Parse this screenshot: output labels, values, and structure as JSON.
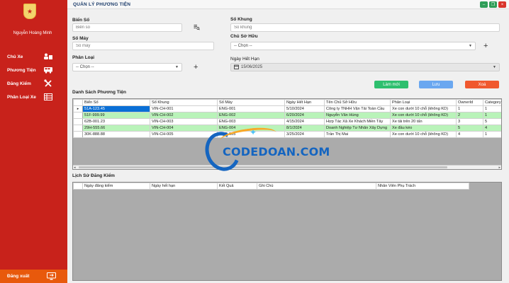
{
  "app": {
    "title": "QUẢN LÝ PHƯƠNG TIỆN",
    "user_name": "Nguyễn Hoàng Minh"
  },
  "sidebar": {
    "items": [
      {
        "label": "Chủ Xe",
        "icon": "owners-icon"
      },
      {
        "label": "Phương Tiện",
        "icon": "bus-icon"
      },
      {
        "label": "Đăng Kiểm",
        "icon": "tools-icon"
      },
      {
        "label": "Phân Loại Xe",
        "icon": "category-icon"
      }
    ],
    "logout_label": "Đăng xuất"
  },
  "form": {
    "bien_so": {
      "label": "Biển Số",
      "placeholder": "Biển số"
    },
    "so_may": {
      "label": "Số Máy",
      "placeholder": "Số máy"
    },
    "phan_loai": {
      "label": "Phân Loại",
      "value": "-- Chọn --"
    },
    "so_khung": {
      "label": "Số Khung",
      "placeholder": "Số khung"
    },
    "chu_so_huu": {
      "label": "Chủ Sở Hữu",
      "value": "-- Chọn --"
    },
    "ngay_het_han": {
      "label": "Ngày Hết Hạn",
      "value": "15/06/2025"
    },
    "plus": "+",
    "buttons": {
      "add": "Làm mới",
      "save": "Lưu",
      "delete": "Xoá"
    }
  },
  "vehicles": {
    "title": "Danh Sách Phương Tiện",
    "columns": [
      "Biển Số",
      "Số Khung",
      "Số Máy",
      "Ngày Hết Hạn",
      "Tên Chủ Sở Hữu",
      "Phân Loại",
      "OwnerId",
      "CategoryId"
    ],
    "rows": [
      [
        "51A-123.45",
        "VIN-CH-001",
        "ENG-001",
        "5/10/2024",
        "Công ty TNHH Vận Tải Toàn Cầu",
        "Xe con dưới 10 chỗ (không KD)",
        "1",
        "1"
      ],
      [
        "51F-999.99",
        "VIN-CH-002",
        "ENG-002",
        "6/20/2024",
        "Nguyễn Văn Hùng",
        "Xe con dưới 10 chỗ (không KD)",
        "2",
        "1"
      ],
      [
        "62B-001.23",
        "VIN-CH-003",
        "ENG-003",
        "4/15/2024",
        "Hợp Tác Xã Xe Khách Miền Tây",
        "Xe tải trên 20 tấn",
        "3",
        "5"
      ],
      [
        "29H-555.66",
        "VIN-CH-004",
        "ENG-004",
        "8/1/2024",
        "Doanh Nghiệp Tư Nhân Xây Dựng",
        "Xe đầu kéo",
        "5",
        "4"
      ],
      [
        "30K-888.88",
        "VIN-CH-005",
        "ENG-005",
        "3/25/2024",
        "Trần Thị Mai",
        "Xe con dưới 10 chỗ (không KD)",
        "4",
        "1"
      ]
    ]
  },
  "inspections": {
    "title": "Lịch Sử Đăng Kiểm",
    "columns": [
      "Ngày đăng kiểm",
      "Ngày hết hạn",
      "Kết Quả",
      "Ghi Chú",
      "Nhân Viên Phụ Trách"
    ]
  },
  "watermark": {
    "text": "CODEDOAN.COM"
  },
  "colors": {
    "sidebar": "#c8221b",
    "logout": "#e8590c",
    "btn_add": "#2ebf6e",
    "btn_save": "#6aa7f0",
    "btn_delete": "#f0582e",
    "row_highlight": "#b9f3b9",
    "selection": "#0a6fd6"
  }
}
